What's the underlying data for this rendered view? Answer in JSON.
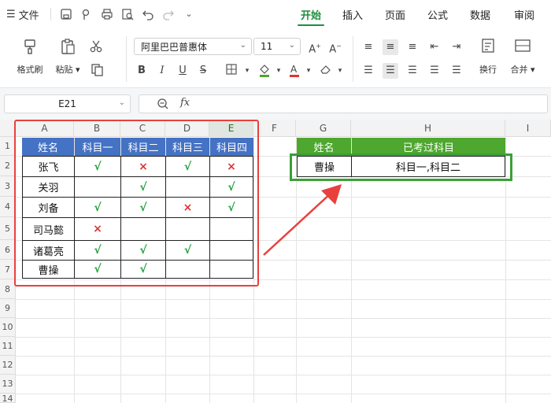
{
  "menubar": {
    "menu_icon": "☰",
    "file_label": "文件",
    "tabs": [
      "开始",
      "插入",
      "页面",
      "公式",
      "数据",
      "审阅"
    ],
    "active_tab": "开始"
  },
  "ribbon": {
    "format_painter": "格式刷",
    "paste": "粘贴",
    "font_name": "阿里巴巴普惠体",
    "font_size": "11",
    "wrap": "换行",
    "merge": "合并"
  },
  "formula_bar": {
    "cell_ref": "E21",
    "fx_label": "fx",
    "content": ""
  },
  "columns": [
    "A",
    "B",
    "C",
    "D",
    "E",
    "F",
    "G",
    "H",
    "I"
  ],
  "selected_column": "E",
  "rows": [
    "1",
    "2",
    "3",
    "4",
    "5",
    "6",
    "7",
    "8",
    "9",
    "10",
    "11",
    "12",
    "13",
    "14"
  ],
  "left_table": {
    "headers": [
      "姓名",
      "科目一",
      "科目二",
      "科目三",
      "科目四"
    ],
    "ok_mark": "√",
    "x_mark": "×",
    "rows": [
      {
        "name": "张飞",
        "marks": [
          "ok",
          "x",
          "ok",
          "x"
        ]
      },
      {
        "name": "关羽",
        "marks": [
          "",
          "ok",
          "",
          "ok"
        ]
      },
      {
        "name": "刘备",
        "marks": [
          "ok",
          "ok",
          "x",
          "ok"
        ]
      },
      {
        "name": "司马懿",
        "marks": [
          "x",
          "",
          "",
          ""
        ]
      },
      {
        "name": "诸葛亮",
        "marks": [
          "ok",
          "ok",
          "ok",
          ""
        ]
      },
      {
        "name": "曹操",
        "marks": [
          "ok",
          "ok",
          "",
          ""
        ]
      }
    ]
  },
  "right_table": {
    "headers": [
      "姓名",
      "已考过科目"
    ],
    "row": {
      "name": "曹操",
      "subjects": "科目一,科目二"
    }
  },
  "colors": {
    "accent_green": "#1e8e3e",
    "header_blue": "#4472c4",
    "header_green": "#4ea72e",
    "highlight_red": "#e8413d",
    "highlight_green": "#3aa035"
  }
}
